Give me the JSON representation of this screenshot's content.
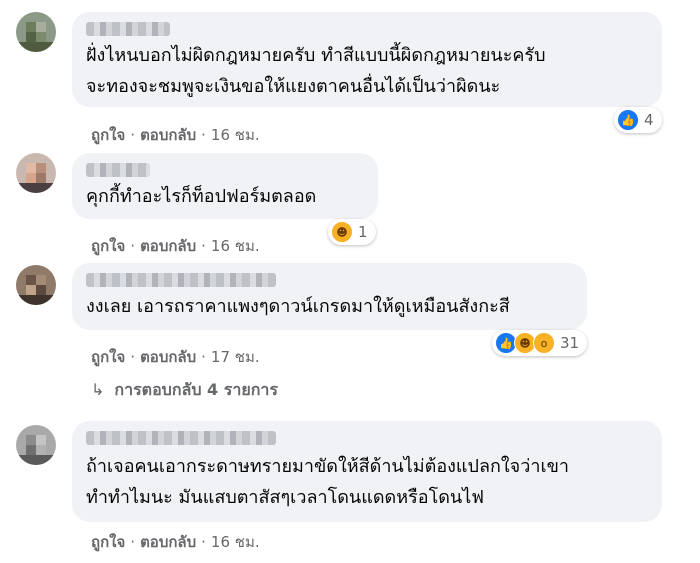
{
  "comments": [
    {
      "text_lines": [
        "ฝั่งไหนบอกไม่ผิดกฎหมายครับ ทำสีแบบนี้ผิดกฎหมายนะครับ",
        "จะทองจะชมพูจะเงินขอให้แยงตาคนอื่นได้เป็นว่าผิดนะ"
      ],
      "like_label": "ถูกใจ",
      "reply_label": "ตอบกลับ",
      "time": "16 ชม.",
      "reaction_icons": [
        "like-icon"
      ],
      "reaction_count": "4"
    },
    {
      "text_lines": [
        "คุกกี้ทำอะไรก็ท็อปฟอร์มตลอด"
      ],
      "like_label": "ถูกใจ",
      "reply_label": "ตอบกลับ",
      "time": "16 ชม.",
      "reaction_icons": [
        "haha-icon"
      ],
      "reaction_count": "1"
    },
    {
      "text_lines": [
        "งงเลย เอารถราคาแพงๆดาวน์เกรดมาให้ดูเหมือนสังกะสี"
      ],
      "like_label": "ถูกใจ",
      "reply_label": "ตอบกลับ",
      "time": "17 ชม.",
      "reaction_icons": [
        "like-icon",
        "haha-icon",
        "wow-icon"
      ],
      "reaction_count": "31"
    },
    {
      "text_lines": [
        "ถ้าเจอคนเอากระดาษทรายมาขัดให้สีด้านไม่ต้องแปลกใจว่าเขา",
        "ทำทำไมนะ มันแสบตาสัสๆเวลาโดนแดดหรือโดนไฟ"
      ],
      "like_label": "ถูกใจ",
      "reply_label": "ตอบกลับ",
      "time": "16 ชม."
    }
  ],
  "replies_toggle": {
    "label": "การตอบกลับ 4 รายการ",
    "icon": "reply-arrow-icon"
  },
  "colors": {
    "bubble": "#f0f2f5",
    "meta": "#65676b",
    "like": "#1877f2",
    "emoji": "#f7b125"
  }
}
